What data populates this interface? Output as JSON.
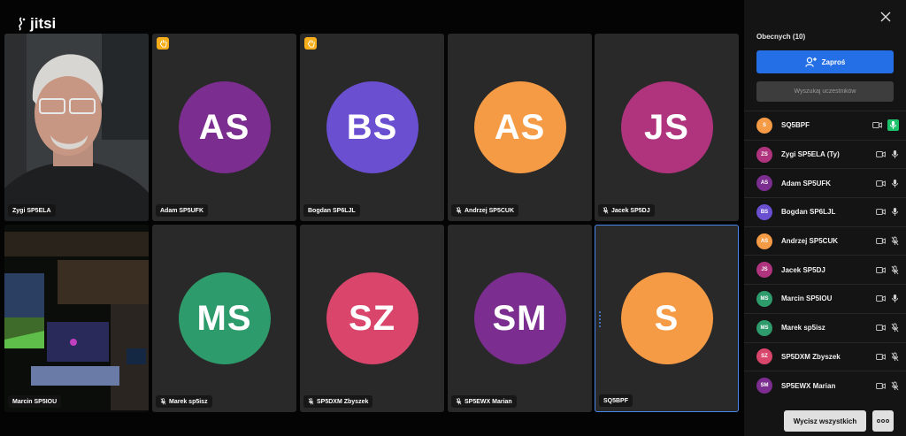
{
  "app": {
    "logo_text": "jitsi"
  },
  "colors": {
    "accent": "#246fe5",
    "active_border": "#4687ed",
    "raise_hand": "#f8ae1a",
    "mic_active": "#1ec26a"
  },
  "tiles": [
    {
      "name": "Zygi SP5ELA",
      "type": "video-portrait",
      "muted": false,
      "raised_hand": false
    },
    {
      "initials": "AS",
      "name": "Adam SP5UFK",
      "color": "#7b2e8f",
      "muted": false,
      "raised_hand": true
    },
    {
      "initials": "BS",
      "name": "Bogdan SP6LJL",
      "color": "#6a4fd1",
      "muted": false,
      "raised_hand": true
    },
    {
      "initials": "AS",
      "name": "Andrzej SP5CUK",
      "color": "#f59b45",
      "muted": true,
      "raised_hand": false
    },
    {
      "initials": "JS",
      "name": "Jacek SP5DJ",
      "color": "#b0347d",
      "muted": true,
      "raised_hand": false
    },
    {
      "name": "Marcin SP5IOU",
      "type": "video-room",
      "muted": false,
      "raised_hand": false
    },
    {
      "initials": "MS",
      "name": "Marek sp5isz",
      "color": "#2e9b6c",
      "muted": true,
      "raised_hand": false
    },
    {
      "initials": "SZ",
      "name": "SP5DXM Zbyszek",
      "color": "#d9456b",
      "muted": true,
      "raised_hand": false
    },
    {
      "initials": "SM",
      "name": "SP5EWX Marian",
      "color": "#7b2e8f",
      "muted": true,
      "raised_hand": false
    },
    {
      "initials": "S",
      "name": "SQ5BPF",
      "color": "#f59b45",
      "muted": false,
      "raised_hand": false,
      "active": true
    }
  ],
  "sidebar": {
    "title": "Obecnych (10)",
    "invite_label": "Zaproś",
    "search_placeholder": "Wyszukaj uczestników",
    "participants": [
      {
        "initials": "S",
        "name": "SQ5BPF",
        "color": "#f59b45",
        "mic": "active"
      },
      {
        "initials": "ZS",
        "name": "Zygi SP5ELA (Ty)",
        "color": "#b0347d",
        "mic": "on"
      },
      {
        "initials": "AS",
        "name": "Adam SP5UFK",
        "color": "#7b2e8f",
        "mic": "on"
      },
      {
        "initials": "BS",
        "name": "Bogdan SP6LJL",
        "color": "#6a4fd1",
        "mic": "on"
      },
      {
        "initials": "AS",
        "name": "Andrzej SP5CUK",
        "color": "#f59b45",
        "mic": "muted"
      },
      {
        "initials": "JS",
        "name": "Jacek SP5DJ",
        "color": "#b0347d",
        "mic": "muted"
      },
      {
        "initials": "MS",
        "name": "Marcin SP5IOU",
        "color": "#2e9b6c",
        "mic": "on"
      },
      {
        "initials": "MS",
        "name": "Marek sp5isz",
        "color": "#2e9b6c",
        "mic": "muted"
      },
      {
        "initials": "SZ",
        "name": "SP5DXM Zbyszek",
        "color": "#d9456b",
        "mic": "muted"
      },
      {
        "initials": "SM",
        "name": "SP5EWX Marian",
        "color": "#7b2e8f",
        "mic": "muted"
      }
    ],
    "mute_all_label": "Wycisz wszystkich"
  }
}
